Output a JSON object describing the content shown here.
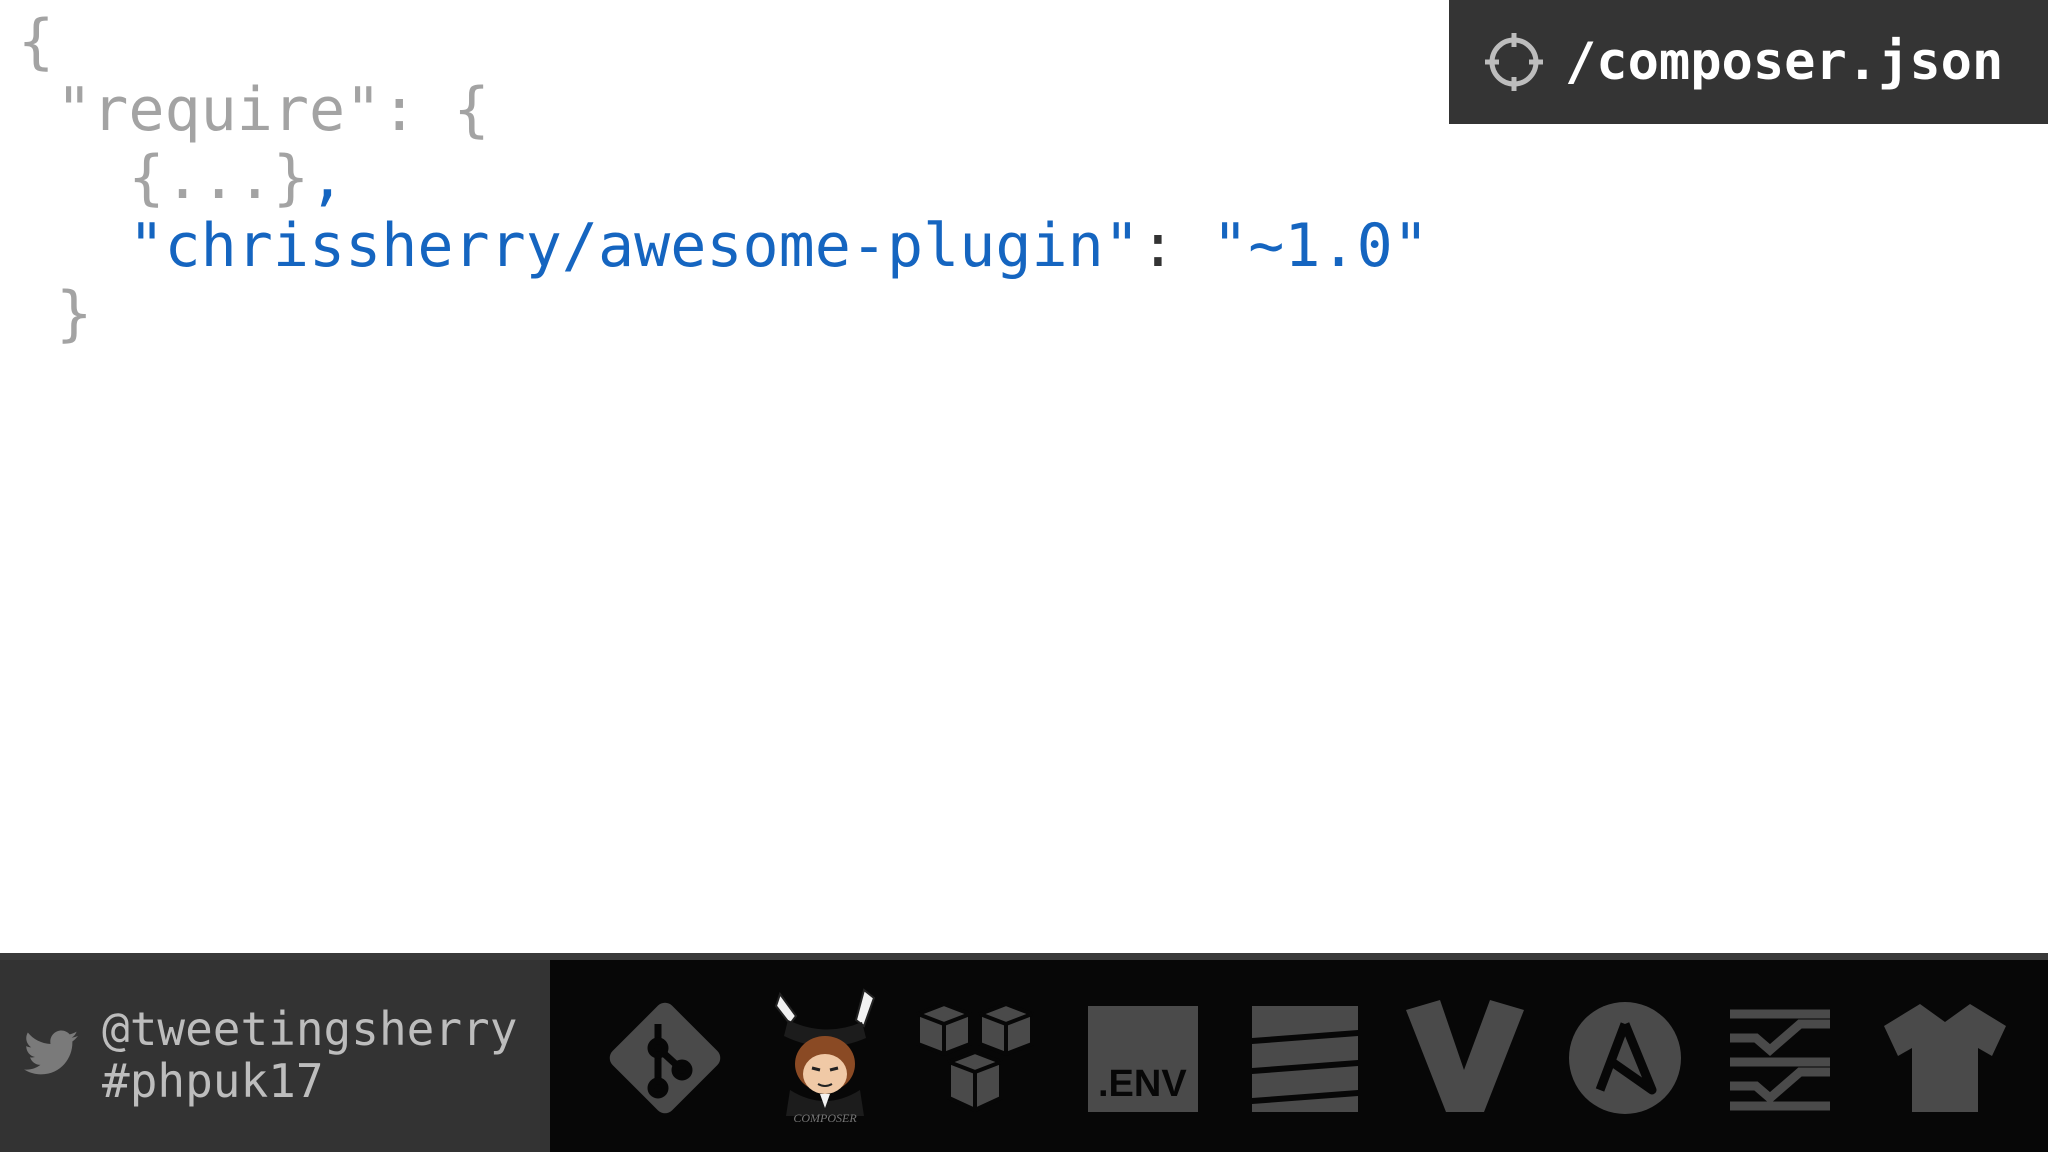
{
  "code": {
    "line1": "{",
    "line2": " \"require\": {",
    "line3_a": "   {...}",
    "line3_b": ",",
    "line4_key": "   \"chrissherry/awesome-plugin\"",
    "line4_colon": ": ",
    "line4_value": "\"~1.0\"",
    "line5": " }"
  },
  "file_badge": {
    "icon": "crosshair-icon",
    "filename": "/composer.json"
  },
  "footer": {
    "twitter_icon": "twitter-bird-icon",
    "handle": "@tweetingsherry",
    "hashtag": "#phpuk17",
    "tools": [
      {
        "icon": "git-icon"
      },
      {
        "icon": "composer-conductor-logo"
      },
      {
        "icon": "aws-cubes-icon"
      },
      {
        "icon": "dotenv-icon",
        "label": ".ENV"
      },
      {
        "icon": "zend-expressive-icon"
      },
      {
        "icon": "vagrant-icon"
      },
      {
        "icon": "ansible-icon",
        "letter": "A"
      },
      {
        "icon": "checklist-icon"
      },
      {
        "icon": "shirt-icon"
      }
    ]
  },
  "colors": {
    "code_gray": "#a3a3a3",
    "code_blue": "#1565c0",
    "badge_bg": "#343434",
    "footer_social_bg": "#333333",
    "footer_tools_bg": "#070707",
    "tool_icon": "#4a4a4a"
  }
}
